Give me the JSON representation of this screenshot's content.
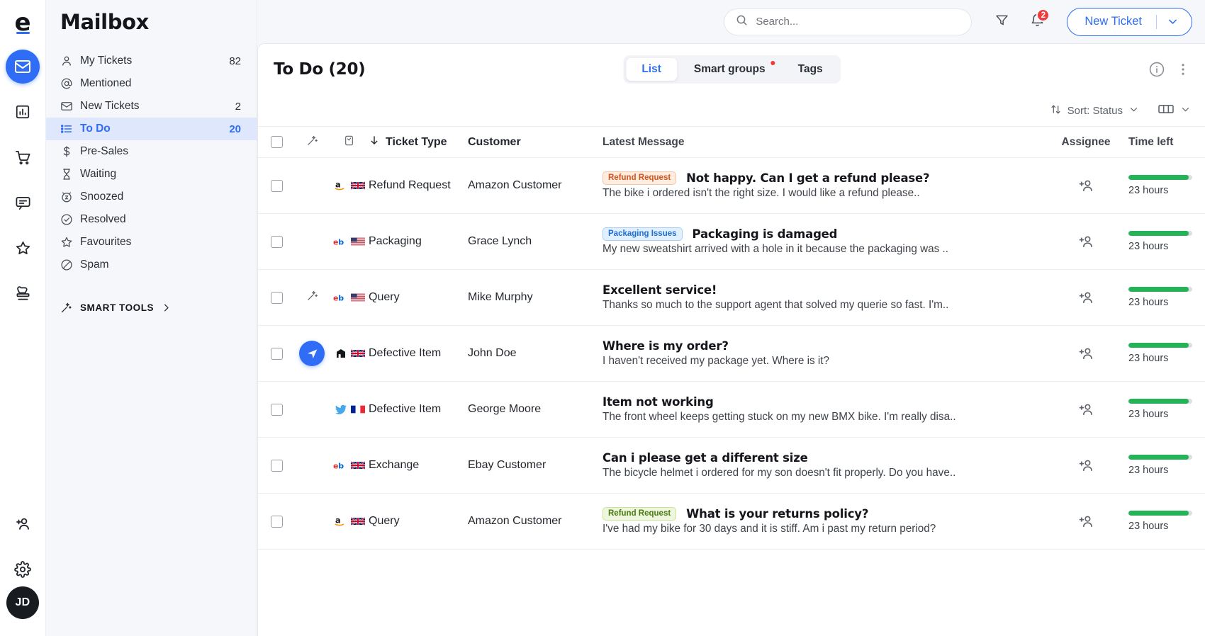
{
  "rail": {
    "logo": "e",
    "items": [
      {
        "name": "mail-icon",
        "active": true
      },
      {
        "name": "chart-icon",
        "active": false
      },
      {
        "name": "cart-icon",
        "active": false
      },
      {
        "name": "chat-icon",
        "active": false
      },
      {
        "name": "star-icon",
        "active": false
      },
      {
        "name": "stamp-icon",
        "active": false
      }
    ],
    "bottom": [
      {
        "name": "add-user-icon"
      },
      {
        "name": "gear-icon"
      }
    ],
    "avatar": "JD"
  },
  "sidebar": {
    "title": "Mailbox",
    "items": [
      {
        "label": "My Tickets",
        "count": "82",
        "icon": "user-icon",
        "active": false
      },
      {
        "label": "Mentioned",
        "count": "",
        "icon": "at-icon",
        "active": false
      },
      {
        "label": "New Tickets",
        "count": "2",
        "icon": "envelope-icon",
        "active": false
      },
      {
        "label": "To Do",
        "count": "20",
        "icon": "list-icon",
        "active": true
      },
      {
        "label": "Pre-Sales",
        "count": "",
        "icon": "dollar-icon",
        "active": false
      },
      {
        "label": "Waiting",
        "count": "",
        "icon": "hourglass-icon",
        "active": false
      },
      {
        "label": "Snoozed",
        "count": "",
        "icon": "snooze-icon",
        "active": false
      },
      {
        "label": "Resolved",
        "count": "",
        "icon": "check-circle-icon",
        "active": false
      },
      {
        "label": "Favourites",
        "count": "",
        "icon": "star-icon",
        "active": false
      },
      {
        "label": "Spam",
        "count": "",
        "icon": "block-icon",
        "active": false
      }
    ],
    "smart_tools": "SMART TOOLS"
  },
  "topbar": {
    "search_placeholder": "Search...",
    "search_value": "",
    "filter_icon": "filter-icon",
    "bell_icon": "bell-icon",
    "bell_badge": "2",
    "new_ticket_label": "New Ticket"
  },
  "panel": {
    "title": "To Do (20)",
    "tabs": [
      {
        "label": "List",
        "active": true,
        "dot": false
      },
      {
        "label": "Smart groups",
        "active": false,
        "dot": true
      },
      {
        "label": "Tags",
        "active": false,
        "dot": false
      }
    ],
    "info_icon": "info-icon",
    "more_icon": "more-vertical-icon",
    "sort_label": "Sort: Status",
    "columns_icon": "columns-icon"
  },
  "table": {
    "headers": {
      "wand": "magic-wand-icon",
      "tag": "tag-icon",
      "type": "Ticket Type",
      "customer": "Customer",
      "message": "Latest Message",
      "assignee": "Assignee",
      "time": "Time left"
    },
    "rows": [
      {
        "channel": "amazon",
        "flag": "gb",
        "wand": false,
        "send": false,
        "type": "Refund Request",
        "customer": "Amazon Customer",
        "tag": "Refund Request",
        "tag_style": "refund",
        "subject": "Not happy. Can I get a refund please?",
        "preview": "The bike i ordered isn't the right size. I would like a refund please..",
        "time": "23 hours",
        "progress": 94
      },
      {
        "channel": "ebay",
        "flag": "us",
        "wand": false,
        "send": false,
        "type": "Packaging",
        "customer": "Grace Lynch",
        "tag": "Packaging Issues",
        "tag_style": "packaging",
        "subject": "Packaging is damaged",
        "preview": "My new sweatshirt arrived with a hole in it because the packaging was ..",
        "time": "23 hours",
        "progress": 94
      },
      {
        "channel": "ebay",
        "flag": "us",
        "wand": true,
        "send": false,
        "type": "Query",
        "customer": "Mike Murphy",
        "tag": "",
        "tag_style": "",
        "subject": "Excellent service!",
        "preview": "Thanks so much to the support agent that solved my querie so fast. I'm..",
        "time": "23 hours",
        "progress": 94
      },
      {
        "channel": "shop",
        "flag": "gb",
        "wand": false,
        "send": true,
        "type": "Defective Item",
        "customer": "John Doe",
        "tag": "",
        "tag_style": "",
        "subject": "Where is my order?",
        "preview": "I haven't received my package yet. Where is it?",
        "time": "23 hours",
        "progress": 94
      },
      {
        "channel": "twitter",
        "flag": "fr",
        "wand": false,
        "send": false,
        "type": "Defective Item",
        "customer": "George Moore",
        "tag": "",
        "tag_style": "",
        "subject": "Item not working",
        "preview": "The front wheel keeps getting stuck on my new BMX bike. I'm really disa..",
        "time": "23 hours",
        "progress": 94
      },
      {
        "channel": "ebay",
        "flag": "gb",
        "wand": false,
        "send": false,
        "type": "Exchange",
        "customer": "Ebay Customer",
        "tag": "",
        "tag_style": "",
        "subject": "Can i please get a different size",
        "preview": "The bicycle helmet i ordered for my son doesn't fit properly. Do you have..",
        "time": "23 hours",
        "progress": 94
      },
      {
        "channel": "amazon",
        "flag": "gb",
        "wand": false,
        "send": false,
        "type": "Query",
        "customer": "Amazon Customer",
        "tag": "Refund Request",
        "tag_style": "returns",
        "subject": "What is your returns policy?",
        "preview": "I've had my bike for 30 days and it is stiff. Am i past my return period?",
        "time": "23 hours",
        "progress": 94
      }
    ]
  },
  "colors": {
    "accent": "#2f6df6",
    "danger": "#ef3b39",
    "success": "#24b457",
    "sidebar_bg": "#f6f7fb"
  }
}
